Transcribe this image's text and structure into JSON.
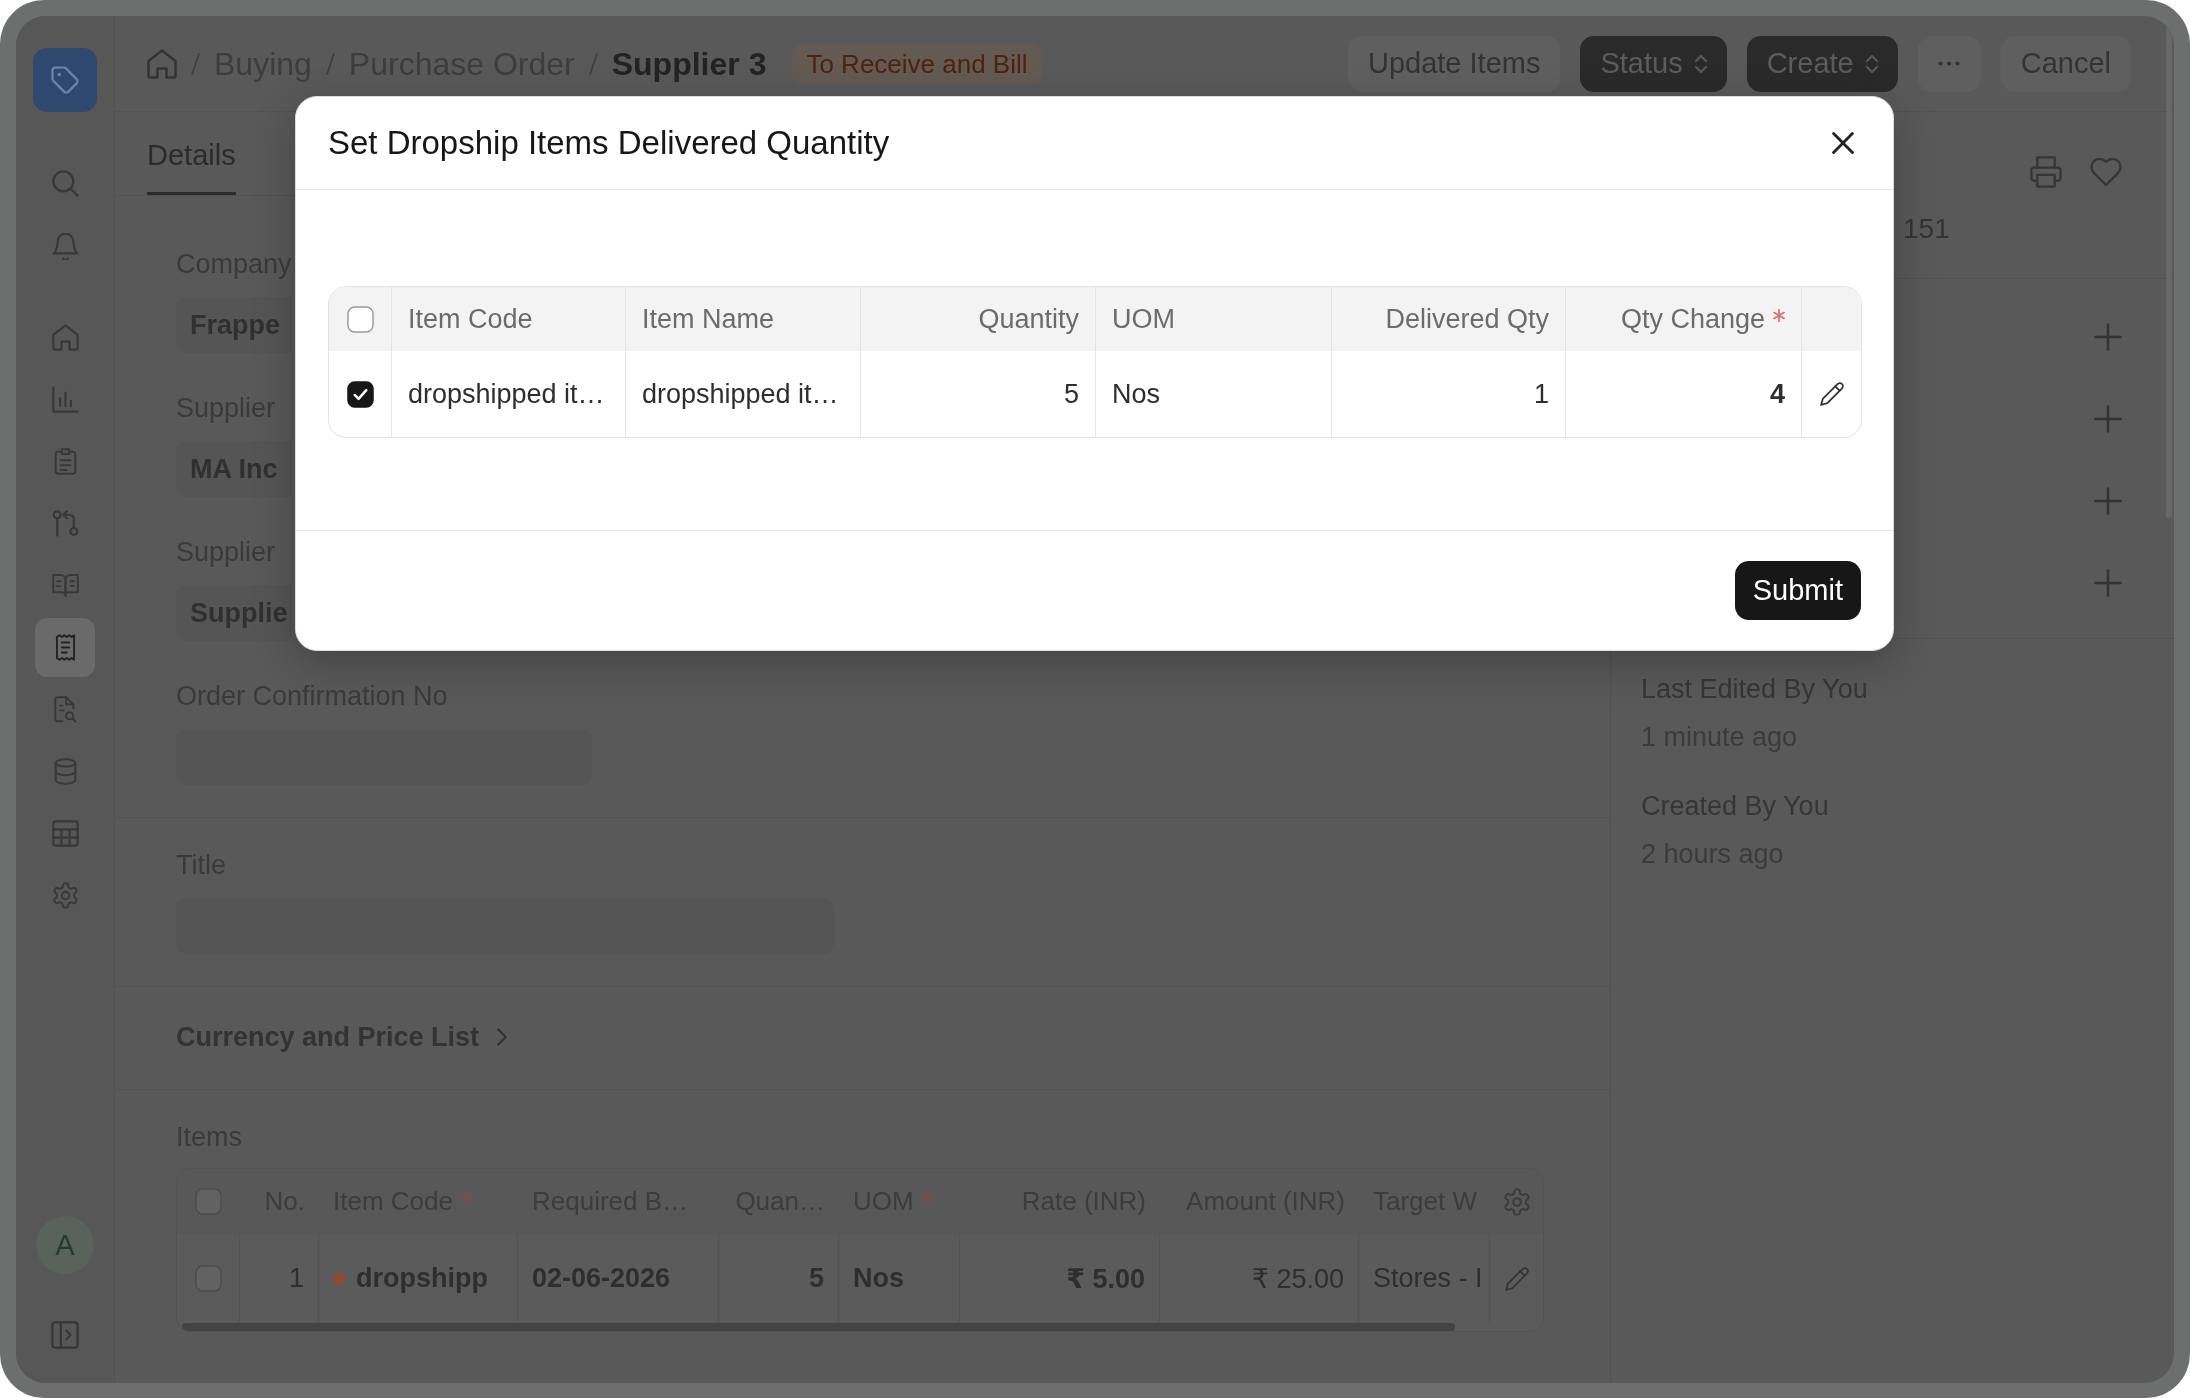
{
  "sidebar": {
    "items": [
      {
        "selected": false
      },
      {
        "selected": false
      },
      {
        "selected": false
      },
      {
        "selected": false
      },
      {
        "selected": false
      },
      {
        "selected": false
      },
      {
        "selected": false
      },
      {
        "selected": true
      },
      {
        "selected": false
      },
      {
        "selected": false
      },
      {
        "selected": false
      },
      {
        "selected": false
      }
    ],
    "avatar": "A"
  },
  "breadcrumb": {
    "items": [
      {
        "label": "Buying",
        "current": false
      },
      {
        "label": "Purchase Order",
        "current": false
      },
      {
        "label": "Supplier 3",
        "current": true
      }
    ],
    "status_badge": "To Receive and Bill"
  },
  "header_buttons": [
    {
      "kind": "subtle",
      "label": "Update Items"
    },
    {
      "kind": "menu",
      "label": "Status"
    },
    {
      "kind": "menu",
      "label": "Create"
    },
    {
      "kind": "more"
    },
    {
      "kind": "subtle",
      "label": "Cancel"
    }
  ],
  "tabs": [
    {
      "label": "Details",
      "selected": true
    }
  ],
  "form": {
    "sections": [
      {
        "fields": [
          {
            "label": "Company",
            "value": "Frappe"
          },
          {
            "label": "Supplier",
            "value": "MA Inc"
          },
          {
            "label": "Supplier",
            "value": "Supplie"
          },
          {
            "label": "Order Confirmation No"
          }
        ]
      },
      {
        "fields": [
          {
            "label": "Title"
          }
        ]
      }
    ],
    "collapsible": {
      "heading": "Currency and Price List",
      "collapsed": true
    },
    "items": {
      "label": "Items",
      "select_all_checked": false,
      "columns": [
        {
          "label": "No.",
          "kind": "numeric",
          "required": false
        },
        {
          "label": "Item Code",
          "kind": "text",
          "required": true
        },
        {
          "label": "Required B…",
          "kind": "text",
          "required": false
        },
        {
          "label": "Quan…",
          "kind": "numeric",
          "required": false
        },
        {
          "label": "UOM",
          "kind": "text",
          "required": true
        },
        {
          "label": "Rate (INR)",
          "kind": "numeric",
          "required": false
        },
        {
          "label": "Amount (INR)",
          "kind": "numeric",
          "required": false
        },
        {
          "label": "Target W",
          "kind": "text",
          "required": false
        }
      ],
      "rows": [
        {
          "checked": false,
          "color": "#8c4b32",
          "cells": [
            "1",
            "dropshipp",
            "02-06-2026",
            "5",
            "Nos",
            "₹ 5.00",
            "₹ 25.00",
            "Stores - I"
          ]
        }
      ]
    }
  },
  "side_panel": {
    "doc_name": "151",
    "activity": [
      {
        "label": "Last Edited By You",
        "time": "1 minute ago"
      },
      {
        "label": "Created By You",
        "time": "2 hours ago"
      }
    ]
  },
  "dialog": {
    "title": "Set Dropship Items Delivered Quantity",
    "select_all_checked": false,
    "columns": [
      {
        "label": "Item Code",
        "kind": "text",
        "required": false
      },
      {
        "label": "Item Name",
        "kind": "text",
        "required": false
      },
      {
        "label": "Quantity",
        "kind": "numeric",
        "required": false
      },
      {
        "label": "UOM",
        "kind": "text",
        "required": false
      },
      {
        "label": "Delivered Qty",
        "kind": "numeric",
        "required": false
      },
      {
        "label": "Qty Change",
        "kind": "numeric",
        "required": true
      }
    ],
    "rows": [
      {
        "checked": true,
        "cells": [
          "dropshipped it…",
          "dropshipped it…",
          "5",
          "Nos",
          "1",
          "4"
        ]
      }
    ],
    "submit": "Submit"
  }
}
